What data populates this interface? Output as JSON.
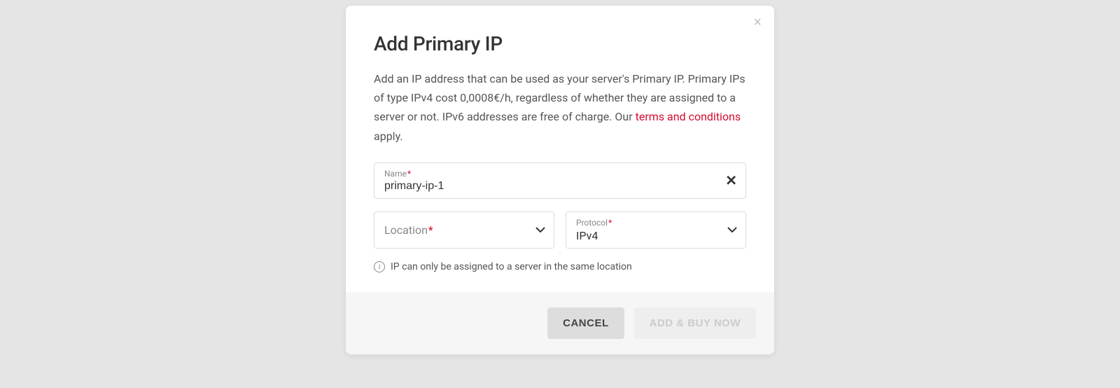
{
  "modal": {
    "title": "Add Primary IP",
    "description_pre": "Add an IP address that can be used as your server's Primary IP. Primary IPs of type IPv4 cost 0,0008€/h, regardless of whether they are assigned to a server or not. IPv6 addresses are free of charge. Our ",
    "terms_link": "terms and conditions",
    "description_post": " apply.",
    "name_field": {
      "label": "Name",
      "value": "primary-ip-1"
    },
    "location_field": {
      "label": "Location"
    },
    "protocol_field": {
      "label": "Protocol",
      "value": "IPv4"
    },
    "info_text": "IP can only be assigned to a server in the same location",
    "cancel_label": "Cancel",
    "submit_label": "Add & Buy now"
  }
}
